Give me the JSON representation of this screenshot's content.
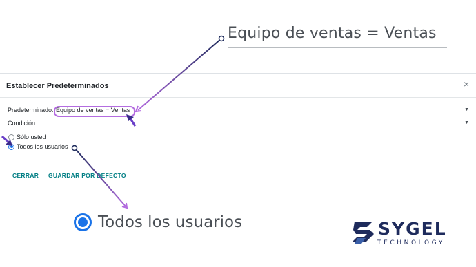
{
  "zoom_top": {
    "text": "Equipo de ventas = Ventas"
  },
  "dialog": {
    "title": "Establecer Predeterminados",
    "close_icon": "×",
    "fields": {
      "default_label": "Predeterminado:",
      "default_value": "Equipo de ventas = Ventas",
      "condition_label": "Condición:",
      "condition_value": ""
    },
    "radio_options": [
      {
        "label": "Sólo usted",
        "checked": false
      },
      {
        "label": "Todos los usuarios",
        "checked": true
      }
    ],
    "buttons": {
      "close": "CERRAR",
      "save_default": "GUARDAR POR DEFECTO"
    }
  },
  "zoom_bottom": {
    "text": "Todos los usuarios"
  },
  "logo": {
    "word": "SYGEL",
    "sub": "TECHNOLOGY"
  },
  "colors": {
    "accent": "#017e84",
    "radio_blue": "#1a73e8",
    "annotation_purple": "#b46de0",
    "annotation_navy": "#1e2b5c"
  },
  "icons": [
    "close-icon",
    "caret-down-icon",
    "arrow-icon",
    "sygel-logo-icon"
  ]
}
